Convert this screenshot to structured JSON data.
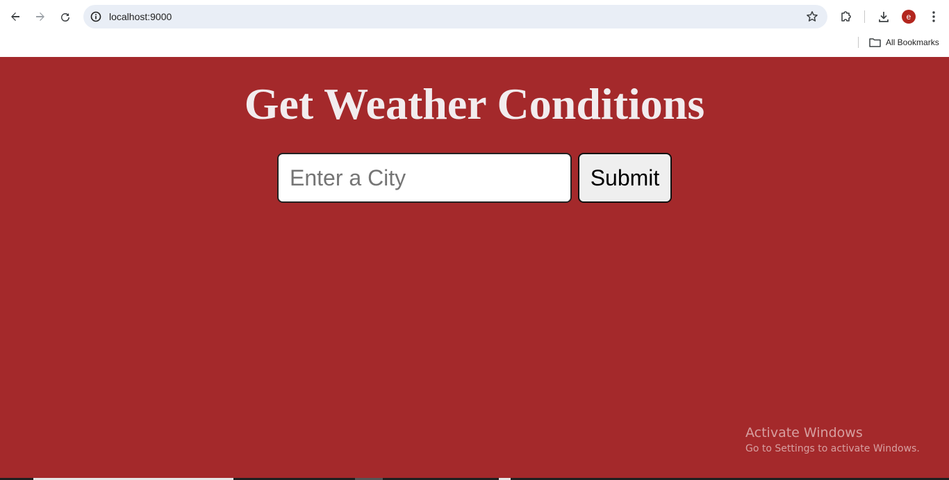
{
  "browser": {
    "url": "localhost:9000",
    "profile_initial": "e",
    "bookmarks_label": "All Bookmarks"
  },
  "icons": {
    "back": "arrow-left-icon",
    "forward": "arrow-right-icon",
    "reload": "reload-icon",
    "site_info": "info-icon",
    "bookmark_star": "star-icon",
    "extensions": "puzzle-icon",
    "downloads": "download-icon",
    "menu": "kebab-menu-icon",
    "bookmarks_folder": "folder-icon"
  },
  "colors": {
    "page_background": "#a4292b",
    "title_color": "#f2ecee",
    "avatar_color": "#b3261e"
  },
  "page": {
    "title": "Get Weather Conditions",
    "city_input": {
      "placeholder": "Enter a City",
      "value": ""
    },
    "submit_label": "Submit"
  },
  "watermark": {
    "title": "Activate Windows",
    "subtitle": "Go to Settings to activate Windows."
  }
}
